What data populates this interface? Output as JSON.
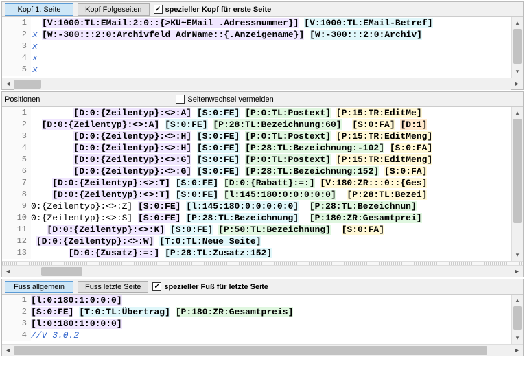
{
  "header": {
    "btn1": "Kopf 1. Seite",
    "btn2": "Kopf Folgeseiten",
    "checkbox_label": "spezieller Kopf für erste Seite",
    "checkbox_checked": "✓",
    "lines": [
      {
        "n": "1",
        "m": "",
        "text": "[V:1000:TL:EMail:2:0::{>KU~EMail .Adressnummer}] [V:1000:TL:EMail-Betreff"
      },
      {
        "n": "2",
        "m": "x",
        "text": "[W:-300:::2:0:Archivfeld AdrName::{.Anzeigename}] [W:-300:::2:0:Archivf"
      },
      {
        "n": "3",
        "m": "x",
        "text": ""
      },
      {
        "n": "4",
        "m": "x",
        "text": ""
      },
      {
        "n": "5",
        "m": "x",
        "text": ""
      }
    ]
  },
  "positions": {
    "label": "Positionen",
    "checkbox_label": "Seitenwechsel vermeiden",
    "lines": [
      {
        "n": "1",
        "text": "        [D:0:{Zeilentyp}:<>:A] [S:0:FE] [P:0:TL:Postext] [P:15:TR:EditMen"
      },
      {
        "n": "2",
        "text": "  [D:0:{Zeilentyp}:<>:A] [S:0:FE] [P:28:TL:Bezeichnung:60]  [S:0:FA] [D:1:"
      },
      {
        "n": "3",
        "text": "        [D:0:{Zeilentyp}:<>:H] [S:0:FE] [P:0:TL:Postext] [P:15:TR:EditMenge"
      },
      {
        "n": "4",
        "text": "        [D:0:{Zeilentyp}:<>:H] [S:0:FE] [P:28:TL:Bezeichnung:-102] [S:0:FA]"
      },
      {
        "n": "5",
        "text": "        [D:0:{Zeilentyp}:<>:G] [S:0:FE] [P:0:TL:Postext] [P:15:TR:EditMenge"
      },
      {
        "n": "6",
        "text": "        [D:0:{Zeilentyp}:<>:G] [S:0:FE] [P:28:TL:Bezeichnung:152] [S:0:FA]"
      },
      {
        "n": "7",
        "text": "    [D:0:{Zeilentyp}:<>:T] [S:0:FE] [D:0:{Rabatt}:=:] [V:180:ZR:::0::{Gesa"
      },
      {
        "n": "8",
        "text": "    [D:0:{Zeilentyp}:<>:T] [S:0:FE] [l:145:180:0:0:0:0:0]  [P:28:TL:Bezeic"
      },
      {
        "n": "9",
        "text": "0:{Zeilentyp}:<>:Z] [S:0:FE] [l:145:180:0:0:0:0:0]  [P:28:TL:Bezeichnung"
      },
      {
        "n": "10",
        "text": "0:{Zeilentyp}:<>:S] [S:0:FE] [P:28:TL:Bezeichnung]  [P:180:ZR:Gesamtpreis"
      },
      {
        "n": "11",
        "text": "   [D:0:{Zeilentyp}:<>:K] [S:0:FE] [P:50:TL:Bezeichnung]  [S:0:FA]"
      },
      {
        "n": "12",
        "text": " [D:0:{Zeilentyp}:<>:W] [T:0:TL:Neue Seite]"
      },
      {
        "n": "13",
        "text": "       [D:0:{Zusatz}:=:] [P:28:TL:Zusatz:152]"
      }
    ]
  },
  "footer": {
    "btn1": "Fuss allgemein",
    "btn2": "Fuss letzte Seite",
    "checkbox_label": "spezieller Fuß für letzte Seite",
    "checkbox_checked": "✓",
    "lines": [
      {
        "n": "1",
        "text": "[l:0:180:1:0:0:0]"
      },
      {
        "n": "2",
        "text": "[S:0:FE] [T:0:TL:Übertrag] [P:180:ZR:Gesamtpreis]"
      },
      {
        "n": "3",
        "text": "[l:0:180:1:0:0:0]"
      },
      {
        "n": "4",
        "text": "//V 3.0.2"
      }
    ]
  }
}
